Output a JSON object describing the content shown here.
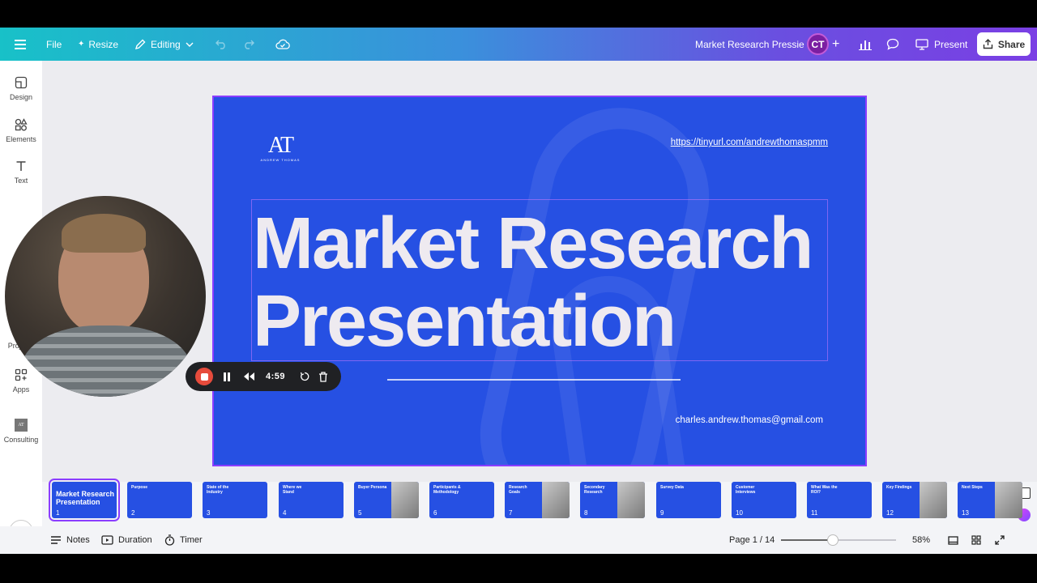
{
  "topbar": {
    "file_label": "File",
    "resize_label": "Resize",
    "editing_label": "Editing",
    "doc_title": "Market Research Pressie",
    "avatar_initials": "CT",
    "present_label": "Present",
    "share_label": "Share"
  },
  "sidebar": {
    "items": [
      {
        "label": "Design"
      },
      {
        "label": "Elements"
      },
      {
        "label": "Text"
      },
      {
        "label": "Projects"
      },
      {
        "label": "Apps"
      },
      {
        "label": "Consulting"
      }
    ]
  },
  "slide": {
    "logo_mark": "AT",
    "logo_sub": "ANDREW THOMAS",
    "url": "https://tinyurl.com/andrewthomaspmm",
    "title_line1": "Market Research",
    "title_line2": "Presentation",
    "email": "charles.andrew.thomas@gmail.com",
    "background_color": "#2650e3"
  },
  "recorder": {
    "time": "4:59"
  },
  "thumbnails": [
    {
      "num": "1",
      "title": "Market Research Presentation"
    },
    {
      "num": "2",
      "title": "Purpose"
    },
    {
      "num": "3",
      "title": "State of the Industry"
    },
    {
      "num": "4",
      "title": "Where we Stand"
    },
    {
      "num": "5",
      "title": "Buyer Persona"
    },
    {
      "num": "6",
      "title": "Participants & Methodology"
    },
    {
      "num": "7",
      "title": "Research Goals"
    },
    {
      "num": "8",
      "title": "Secondary Research"
    },
    {
      "num": "9",
      "title": "Survey Data"
    },
    {
      "num": "10",
      "title": "Customer Interviews"
    },
    {
      "num": "11",
      "title": "What Was the ROI?"
    },
    {
      "num": "12",
      "title": "Key Findings"
    },
    {
      "num": "13",
      "title": "Next Steps"
    }
  ],
  "bottombar": {
    "notes_label": "Notes",
    "duration_label": "Duration",
    "timer_label": "Timer",
    "page_indicator": "Page 1 / 14",
    "zoom": "58%",
    "zoom_fraction": 0.58
  },
  "colors": {
    "accent": "#8b3dff",
    "slide_blue": "#2650e3",
    "record_red": "#e64b3c"
  }
}
